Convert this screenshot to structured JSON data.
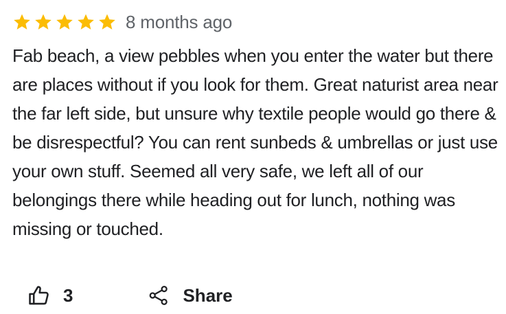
{
  "review": {
    "rating": 5,
    "rating_max": 5,
    "star_color": "#fbbc04",
    "time_ago": "8 months ago",
    "text": "Fab beach, a view pebbles when you enter the water but there are places without if you look for them. Great naturist area near the far left side, but unsure why textile people would go there & be disrespectful? You can rent sunbeds & umbrellas or just use your own stuff. Seemed all very safe, we left all of our belongings there while heading out for lunch, nothing was missing or touched."
  },
  "actions": {
    "like_icon": "thumbs-up-icon",
    "like_count": "3",
    "share_icon": "share-icon",
    "share_label": "Share"
  }
}
